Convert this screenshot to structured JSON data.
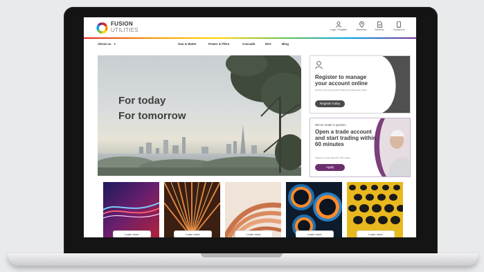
{
  "brand": {
    "name_line1": "FUSION",
    "name_line2": "UTILITIES",
    "logo_colors": [
      "#e2231a",
      "#f39200",
      "#ffd400",
      "#6cc04a",
      "#00a0e3",
      "#7b2d8e"
    ]
  },
  "utility_links": [
    {
      "label": "Login / Register",
      "icon": "user-icon"
    },
    {
      "label": "Branches",
      "icon": "location-pin-icon"
    },
    {
      "label": "Services",
      "icon": "document-icon"
    },
    {
      "label": "Contact us",
      "icon": "phone-icon"
    }
  ],
  "nav": {
    "about": "About us",
    "items": [
      "Gas & Water",
      "Power & Fibre",
      "Cascade",
      "Hire",
      "Blog"
    ]
  },
  "hero": {
    "line1": "For today",
    "line2": "For tomorrow"
  },
  "card_register": {
    "title": "Register to manage your account online",
    "small": "Access to all your account credits and statements online",
    "button": "Register today",
    "icon": "user-icon"
  },
  "card_trade": {
    "kicker": "We've made it quicker...",
    "title": "Open a trade account and start trading within 60 minutes",
    "small": "Subject to credit approval. T&Cs apply.",
    "button": "Apply"
  },
  "tiles": [
    {
      "label": "Learn more",
      "image": "electric-light-streaks"
    },
    {
      "label": "Learn more",
      "image": "fibre-optic-cables"
    },
    {
      "label": "Learn more",
      "image": "copper-pipes-coil"
    },
    {
      "label": "Learn more",
      "image": "blue-pipe-ends"
    },
    {
      "label": "Learn more",
      "image": "yellow-perforated-metal"
    }
  ],
  "colors": {
    "accent_purple": "#6c2f6e",
    "button_dark": "#4a4a4a",
    "heading_dark": "#3a3a3a"
  }
}
